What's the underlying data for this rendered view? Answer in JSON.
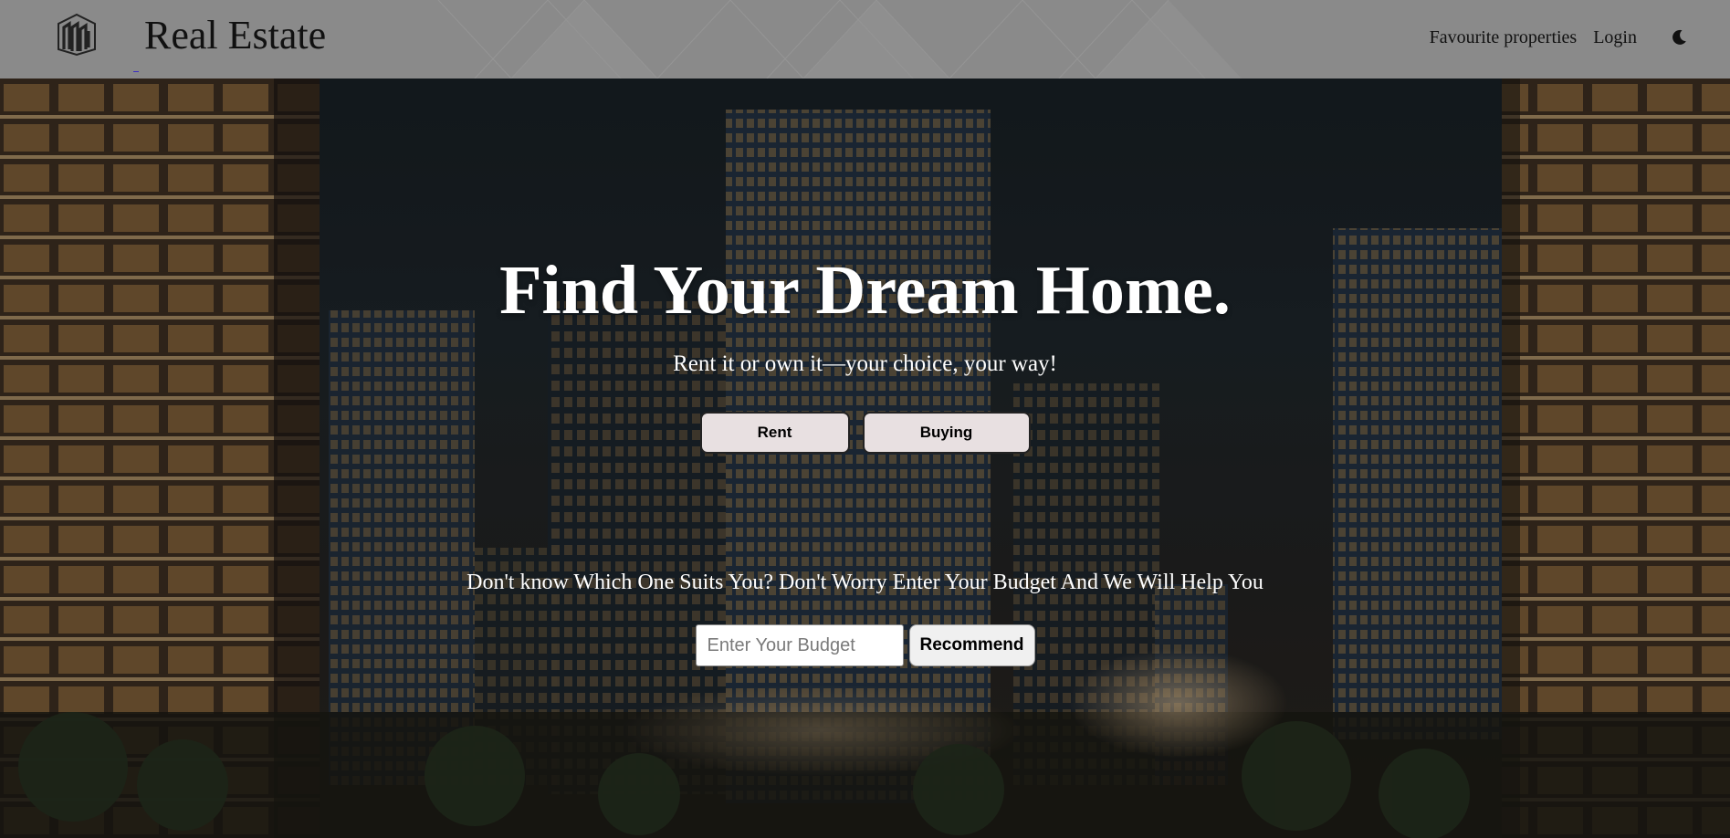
{
  "nav": {
    "brand": "Real Estate",
    "links": [
      {
        "label": "Favourite properties"
      },
      {
        "label": "Login"
      }
    ],
    "theme_toggle_icon": "moon-icon"
  },
  "hero": {
    "title": "Find Your Dream Home.",
    "subtitle": "Rent it or own it—your choice, your way!",
    "buttons": {
      "rent": "Rent",
      "buying": "Buying"
    },
    "help_text": "Don't know Which One Suits You? Don't Worry Enter Your Budget And We Will Help You",
    "budget": {
      "placeholder": "Enter Your Budget",
      "value": "",
      "submit": "Recommend"
    }
  },
  "colors": {
    "nav_bg": "#8a8a8a",
    "button_bg": "#e8e0e1",
    "hero_text": "#ffffff"
  }
}
